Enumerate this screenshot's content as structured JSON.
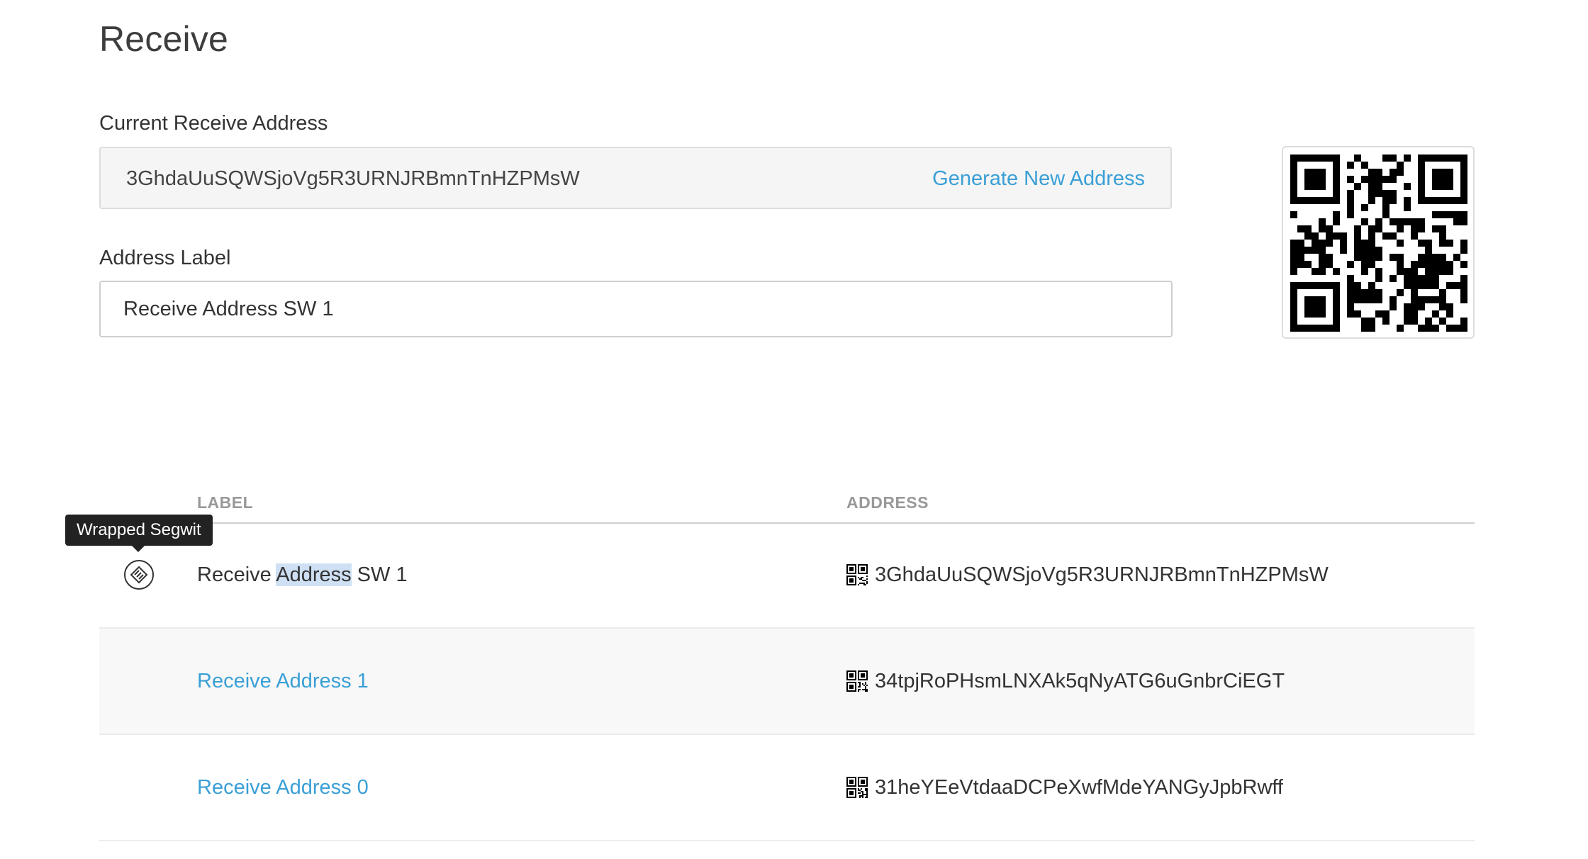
{
  "page": {
    "title": "Receive"
  },
  "current_address": {
    "label": "Current Receive Address",
    "value": "3GhdaUuSQWSjoVg5R3URNJRBmnTnHZPMsW",
    "generate_label": "Generate New Address"
  },
  "address_label": {
    "label": "Address Label",
    "value": "Receive Address SW 1"
  },
  "tooltip": {
    "text": "Wrapped Segwit"
  },
  "table": {
    "headers": {
      "label": "LABEL",
      "address": "ADDRESS"
    },
    "rows": [
      {
        "label_pre": "Receive ",
        "label_highlight": "Address",
        "label_post": " SW 1",
        "address": "3GhdaUuSQWSjoVg5R3URNJRBmnTnHZPMsW",
        "type_icon": "wrapped-segwit-icon"
      },
      {
        "label": "Receive Address 1",
        "address": "34tpjRoPHsmLNXAk5qNyATG6uGnbrCiEGT"
      },
      {
        "label": "Receive Address 0",
        "address": "31heYEeVtdaaDCPeXwfMdeYANGyJpbRwff"
      }
    ]
  },
  "colors": {
    "link": "#3a9fd6",
    "text": "#333333",
    "header": "#999999",
    "tooltip_bg": "#222222",
    "selection": "#cfe0f4"
  }
}
